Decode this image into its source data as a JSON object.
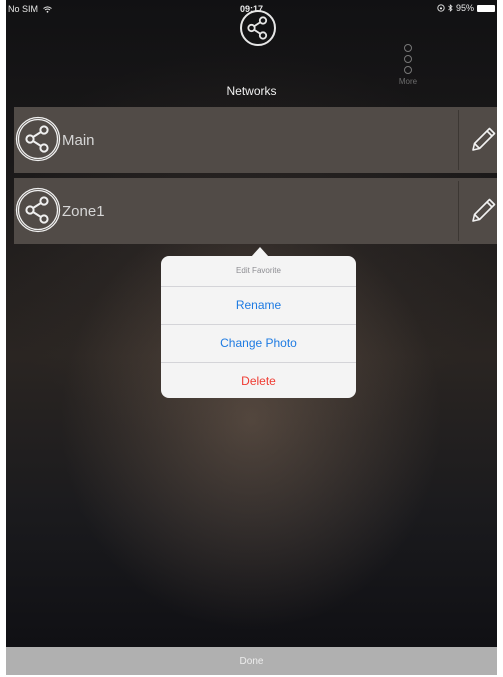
{
  "status": {
    "carrier": "No SIM",
    "time": "09:17",
    "battery": "95%"
  },
  "header": {
    "title": "Networks",
    "more_label": "More"
  },
  "networks": [
    {
      "name": "Main"
    },
    {
      "name": "Zone1"
    }
  ],
  "popover": {
    "title": "Edit Favorite",
    "rename": "Rename",
    "change_photo": "Change Photo",
    "delete": "Delete"
  },
  "footer": {
    "done_label": "Done"
  },
  "icons": {
    "network": "share-network-icon",
    "edit": "pencil-icon",
    "more": "three-dots-vertical-icon",
    "wifi": "wifi-icon",
    "bluetooth": "bluetooth-icon",
    "lock": "rotation-lock-icon",
    "battery": "battery-icon"
  },
  "colors": {
    "action_blue": "#1e7be2",
    "delete_red": "#ef3b32",
    "row_bg": "#514b47"
  }
}
